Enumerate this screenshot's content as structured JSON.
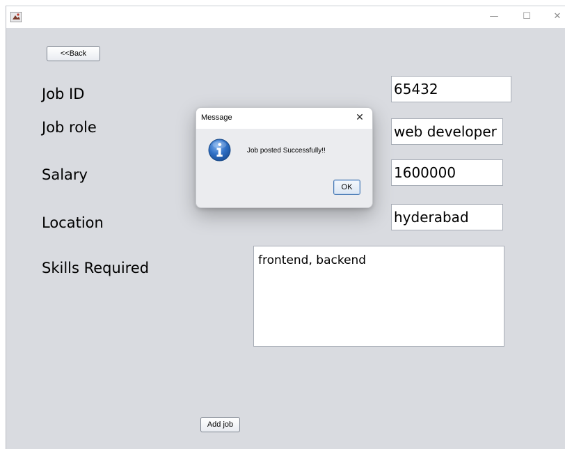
{
  "window": {
    "app_icon": "java-cup-icon",
    "controls": {
      "minimize": "—",
      "maximize": "☐",
      "close": "✕"
    }
  },
  "form": {
    "back_label": "<<Back",
    "labels": {
      "job_id": "Job ID",
      "job_role": "Job role",
      "salary": "Salary",
      "location": "Location",
      "skills": "Skills Required"
    },
    "values": {
      "job_id": "65432",
      "job_role": "web developer",
      "salary": "1600000",
      "location": "hyderabad",
      "skills": "frontend, backend"
    },
    "add_job_label": "Add job"
  },
  "dialog": {
    "title": "Message",
    "close_glyph": "✕",
    "icon": "information-icon",
    "message": "Job posted Successfully!!",
    "ok_label": "OK"
  },
  "colors": {
    "background": "#d9dbe0",
    "dialog_icon": "#2f6fc4",
    "ok_border": "#4a7bb5"
  }
}
